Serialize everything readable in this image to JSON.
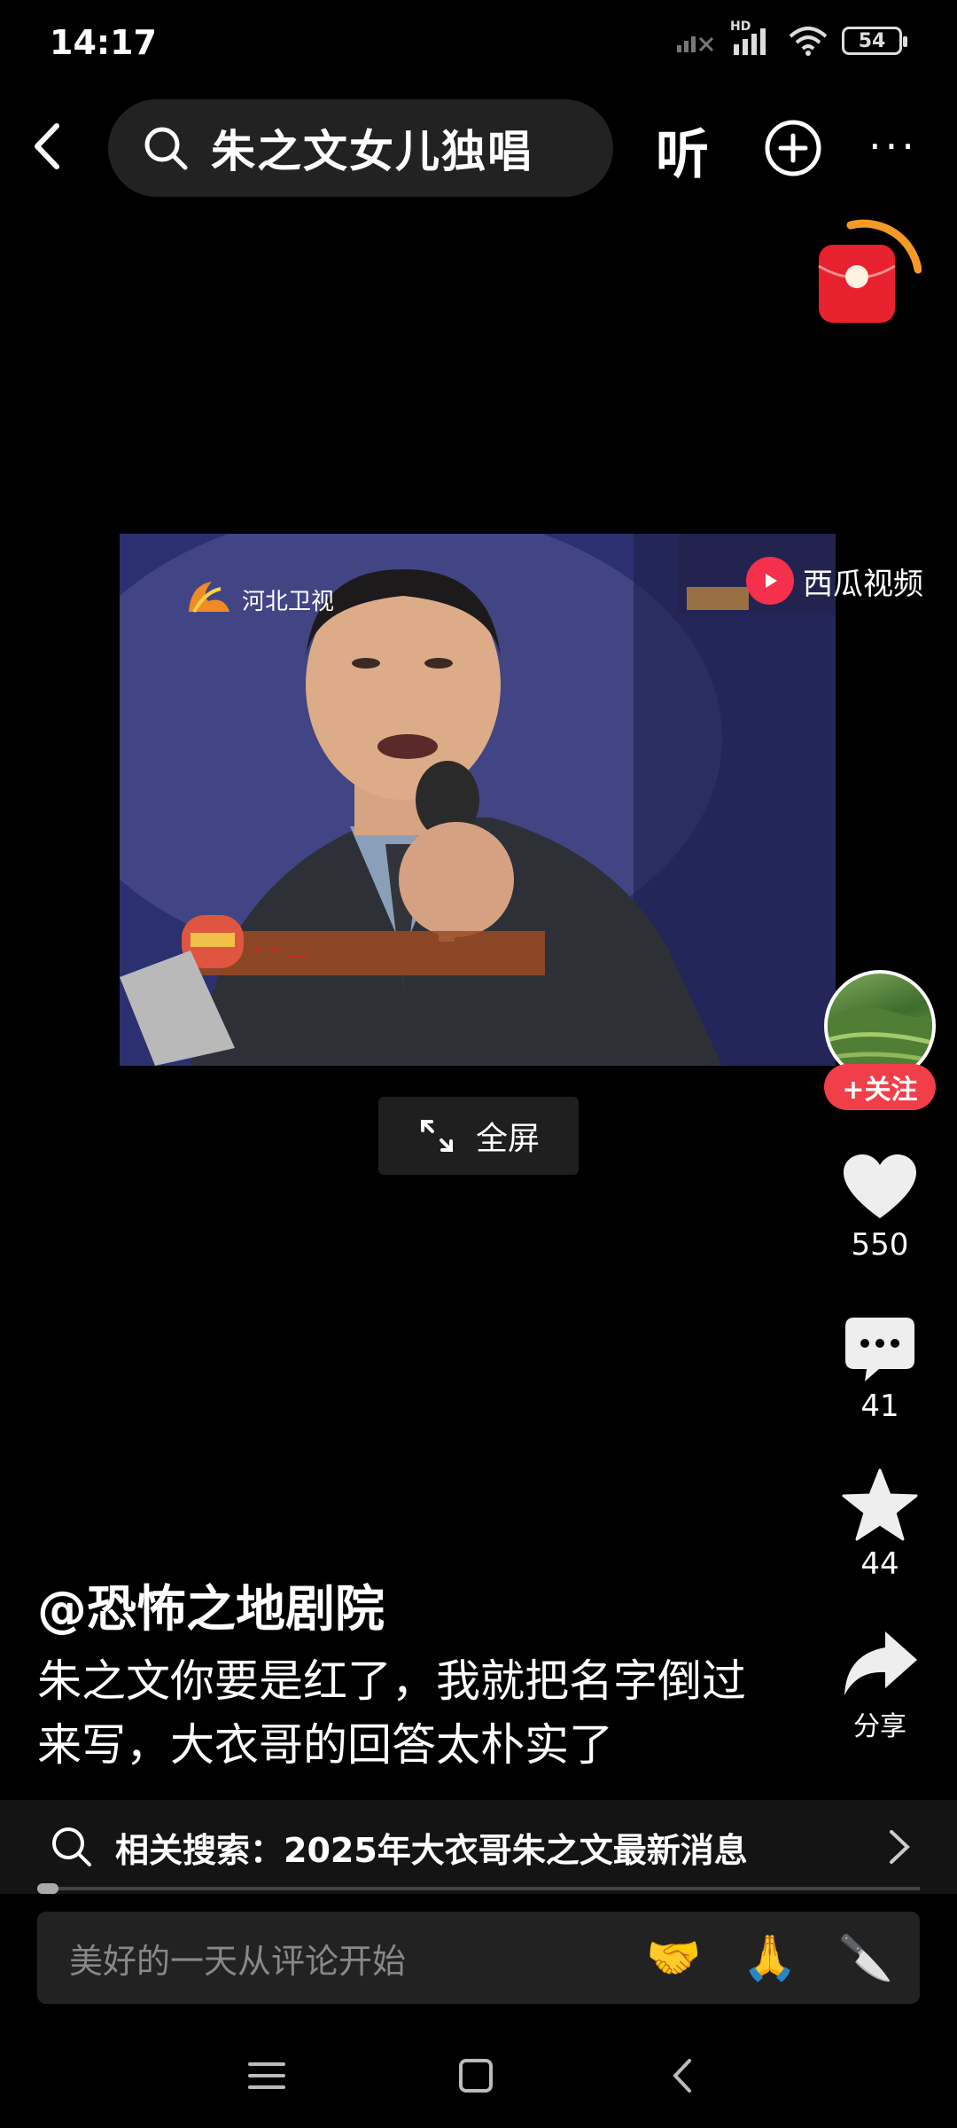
{
  "status_bar": {
    "time": "14:17",
    "network": "HD",
    "battery": "54"
  },
  "top_bar": {
    "search_query": "朱之文女儿独唱",
    "listen_label": "听"
  },
  "video": {
    "channel_logo_text": "河北卫视",
    "watermark": "西瓜视频",
    "fullscreen_label": "全屏"
  },
  "actions": {
    "follow_label": "+关注",
    "likes": "550",
    "comments": "41",
    "favorites": "44",
    "share_label": "分享"
  },
  "post": {
    "author": "@恐怖之地剧院",
    "description": "朱之文你要是红了，我就把名字倒过来写，大衣哥的回答太朴实了"
  },
  "related_search": {
    "text": "相关搜索：2025年大衣哥朱之文最新消息"
  },
  "comment_input": {
    "placeholder": "美好的一天从评论开始",
    "emojis": [
      "🤝",
      "🙏",
      "🔪"
    ]
  },
  "icons": [
    "back-icon",
    "search-icon",
    "plus-circle-icon",
    "more-icon",
    "red-packet-icon",
    "heart-icon",
    "comment-icon",
    "star-icon",
    "share-icon",
    "expand-icon",
    "chevron-right-icon",
    "menu-icon",
    "home-square-icon",
    "nav-back-icon"
  ],
  "colors": {
    "follow": "#f13e48",
    "xigua": "#f4304d",
    "background": "#000000"
  }
}
